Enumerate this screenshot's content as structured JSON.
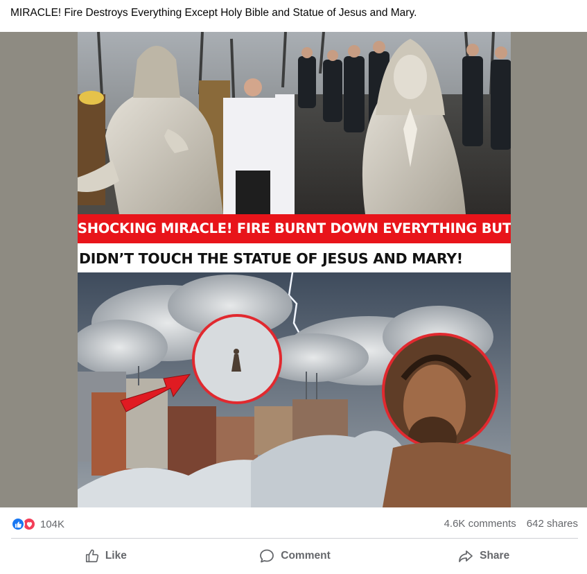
{
  "post": {
    "caption": "MIRACLE! Fire Destroys Everything Except Holy Bible and Statue of Jesus and Mary."
  },
  "image": {
    "banner_line1": "SHOCKING MIRACLE! FIRE BURNT DOWN EVERYTHING BUT",
    "banner_line2": "DIDN’T TOUCH THE STATUE OF JESUS AND MARY!",
    "colors": {
      "banner_red": "#e8141a",
      "banner_white": "#ffffff",
      "letterbox": "#8e8b82"
    }
  },
  "stats": {
    "reaction_icons": [
      "like-icon",
      "love-icon"
    ],
    "reaction_count": "104K",
    "comments": "4.6K comments",
    "shares": "642 shares"
  },
  "actions": {
    "like_label": "Like",
    "comment_label": "Comment",
    "share_label": "Share",
    "icons": [
      "thumbs-up-icon",
      "comment-bubble-icon",
      "share-arrow-icon"
    ]
  },
  "colors": {
    "text_primary": "#050505",
    "text_secondary": "#65676b",
    "like_blue": "#1877f2",
    "love_red": "#f33e58",
    "divider": "#ced0d4"
  }
}
